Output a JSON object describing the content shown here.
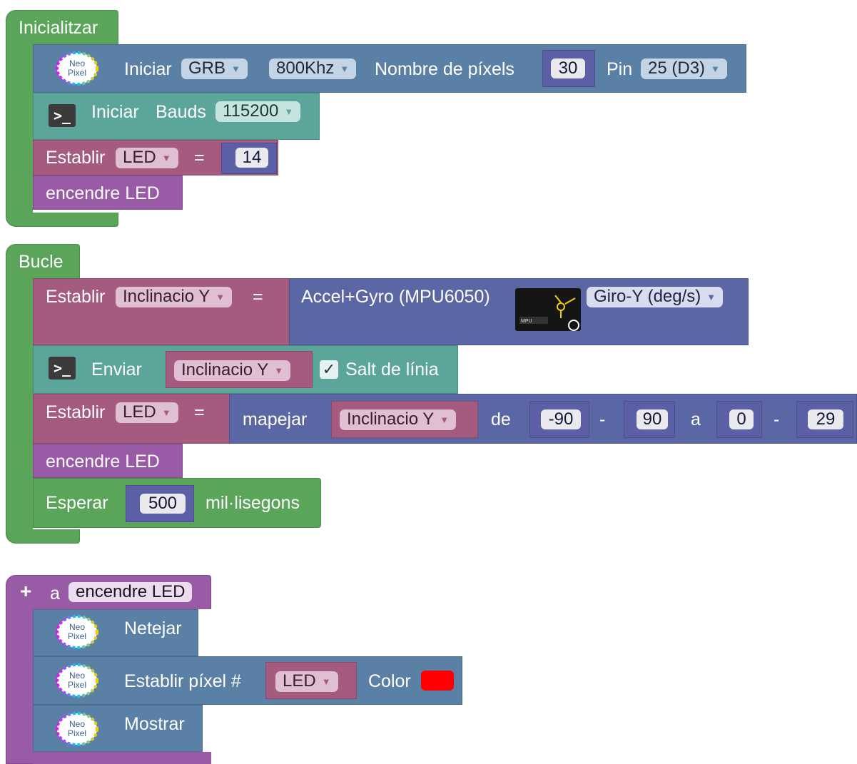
{
  "init": {
    "hat_label": "Inicialitzar",
    "neopixel": {
      "logo_text_top": "Neo",
      "logo_text_bottom": "Pixel",
      "start_label": "Iniciar",
      "order_value": "GRB",
      "freq_value": "800Khz",
      "count_label": "Nombre de píxels",
      "count_value": "30",
      "pin_label": "Pin",
      "pin_value": "25 (D3)"
    },
    "serial": {
      "icon": ">_",
      "start_label": "Iniciar",
      "bauds_label": "Bauds",
      "bauds_value": "115200"
    },
    "set_led": {
      "label": "Establir",
      "var": "LED",
      "eq": "=",
      "value": "14"
    },
    "call": "encendre LED"
  },
  "loop": {
    "hat_label": "Bucle",
    "set_tilt": {
      "label": "Establir",
      "var": "Inclinacio Y",
      "eq": "=",
      "sensor_label": "Accel+Gyro (MPU6050)",
      "axis_value": "Giro-Y (deg/s)"
    },
    "send": {
      "icon": ">_",
      "label": "Enviar",
      "var": "Inclinacio Y",
      "check": "✓",
      "newline_label": "Salt de línia"
    },
    "set_led": {
      "label": "Establir",
      "var": "LED",
      "eq": "=",
      "map_label": "mapejar",
      "map_var": "Inclinacio Y",
      "from_label": "de",
      "from_low": "-90",
      "dash1": "-",
      "from_high": "90",
      "to_label": "a",
      "to_low": "0",
      "dash2": "-",
      "to_high": "29"
    },
    "call": "encendre LED",
    "wait": {
      "label": "Esperar",
      "value": "500",
      "unit": "mil·lisegons"
    }
  },
  "func": {
    "plus": "+",
    "to_label": "a",
    "name": "encendre LED",
    "clear_label": "Netejar",
    "set_pixel_label": "Establir píxel #",
    "pixel_var": "LED",
    "color_label": "Color",
    "color_value": "#ff0000",
    "show_label": "Mostrar"
  }
}
